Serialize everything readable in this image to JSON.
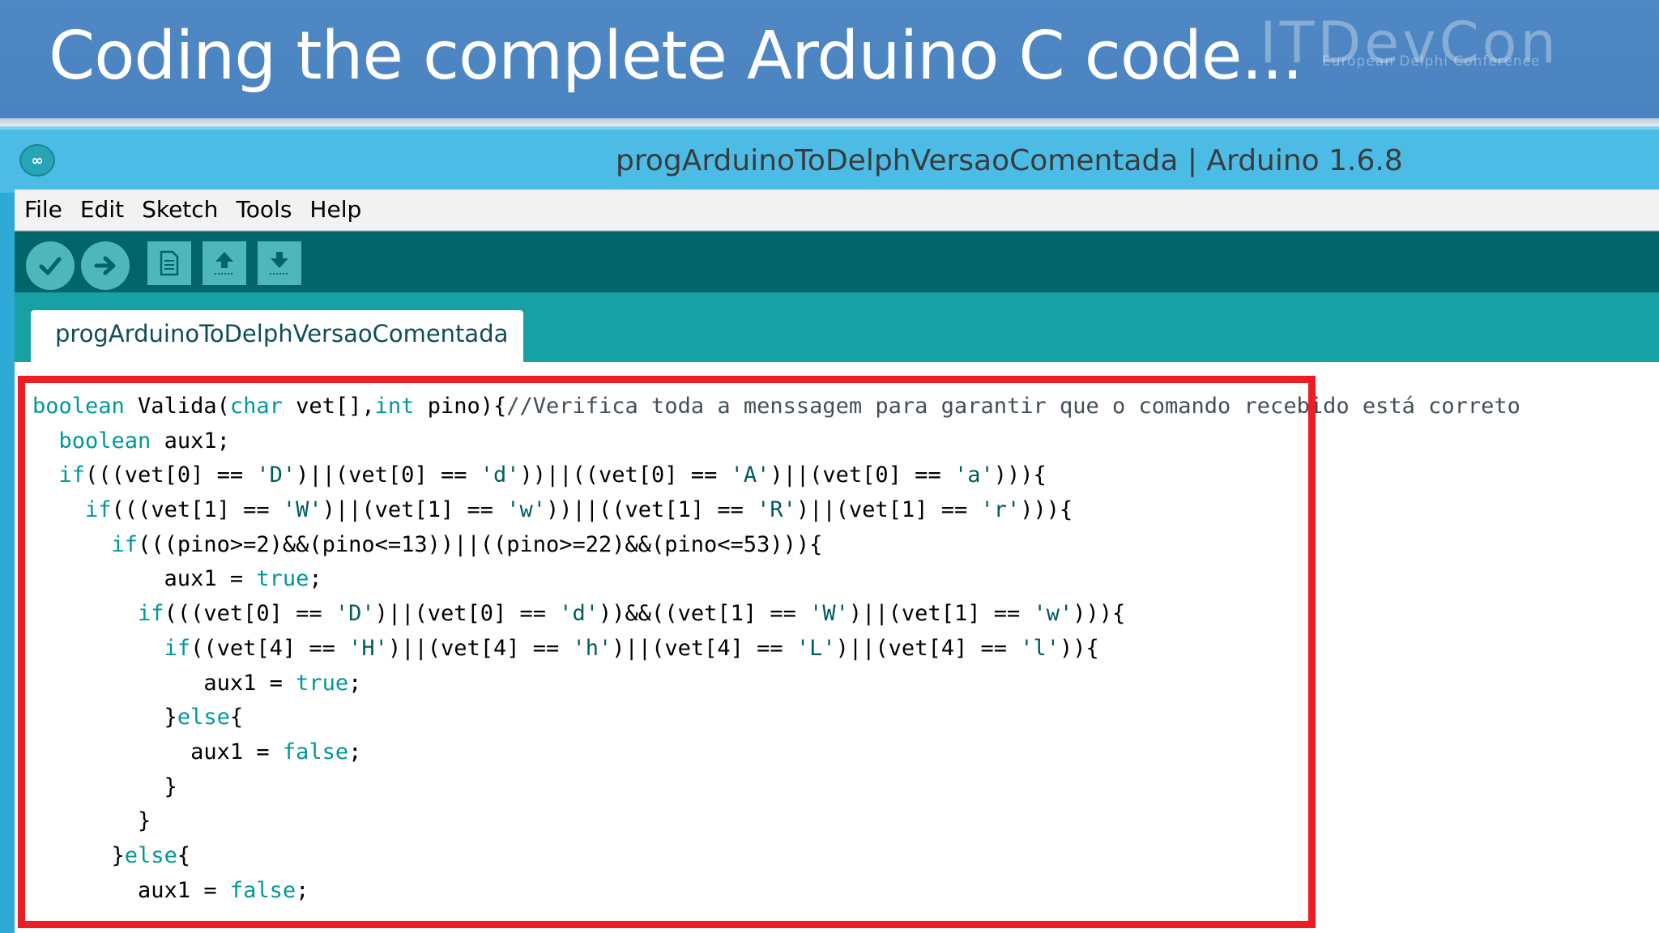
{
  "slide": {
    "title": "Coding the complete Arduino C code...",
    "logo": {
      "name": "ITDevCon",
      "subtitle": "European Delphi Conference"
    }
  },
  "window": {
    "icon": "arduino-infinity-icon",
    "title": "progArduinoToDelphVersaoComentada | Arduino 1.6.8"
  },
  "menu": [
    "File",
    "Edit",
    "Sketch",
    "Tools",
    "Help"
  ],
  "toolbar": [
    {
      "name": "verify",
      "icon": "checkmark-icon"
    },
    {
      "name": "upload",
      "icon": "arrow-right-icon"
    },
    {
      "name": "new",
      "icon": "new-file-icon"
    },
    {
      "name": "open",
      "icon": "open-up-arrow-icon"
    },
    {
      "name": "save",
      "icon": "save-down-arrow-icon"
    }
  ],
  "tab": {
    "label": "progArduinoToDelphVersaoComentada"
  },
  "colors": {
    "keyword": "#00979c",
    "string": "#005c5f",
    "highlight_border": "#ee1c24",
    "toolbar_bg": "#006468",
    "tabbar_bg": "#17a1a5"
  },
  "code": [
    [
      [
        "kw",
        "boolean"
      ],
      [
        "t",
        " Valida("
      ],
      [
        "kw",
        "char"
      ],
      [
        "t",
        " vet[],"
      ],
      [
        "kw",
        "int"
      ],
      [
        "t",
        " pino){"
      ],
      [
        "cm",
        "//Verifica toda a menssagem para garantir que o comando recebido está correto"
      ]
    ],
    [
      [
        "t",
        "  "
      ],
      [
        "kw",
        "boolean"
      ],
      [
        "t",
        " aux1;"
      ]
    ],
    [
      [
        "t",
        "  "
      ],
      [
        "kw",
        "if"
      ],
      [
        "t",
        "(((vet[0] == "
      ],
      [
        "str",
        "'D'"
      ],
      [
        "t",
        ")||(vet[0] == "
      ],
      [
        "str",
        "'d'"
      ],
      [
        "t",
        "))||((vet[0] == "
      ],
      [
        "str",
        "'A'"
      ],
      [
        "t",
        ")||(vet[0] == "
      ],
      [
        "str",
        "'a'"
      ],
      [
        "t",
        ")))"
      ],
      [
        "t",
        "{"
      ]
    ],
    [
      [
        "t",
        "    "
      ],
      [
        "kw",
        "if"
      ],
      [
        "t",
        "(((vet[1] == "
      ],
      [
        "str",
        "'W'"
      ],
      [
        "t",
        ")||(vet[1] == "
      ],
      [
        "str",
        "'w'"
      ],
      [
        "t",
        "))||((vet[1] == "
      ],
      [
        "str",
        "'R'"
      ],
      [
        "t",
        ")||(vet[1] == "
      ],
      [
        "str",
        "'r'"
      ],
      [
        "t",
        ")))"
      ],
      [
        "t",
        "{"
      ]
    ],
    [
      [
        "t",
        "      "
      ],
      [
        "kw",
        "if"
      ],
      [
        "t",
        "(((pino>=2)&&(pino<=13))||((pino>=22)&&(pino<=53))){"
      ]
    ],
    [
      [
        "t",
        "          aux1 = "
      ],
      [
        "kw",
        "true"
      ],
      [
        "t",
        ";"
      ]
    ],
    [
      [
        "t",
        "        "
      ],
      [
        "kw",
        "if"
      ],
      [
        "t",
        "(((vet[0] == "
      ],
      [
        "str",
        "'D'"
      ],
      [
        "t",
        ")||(vet[0] == "
      ],
      [
        "str",
        "'d'"
      ],
      [
        "t",
        "))&&((vet[1] == "
      ],
      [
        "str",
        "'W'"
      ],
      [
        "t",
        ")||(vet[1] == "
      ],
      [
        "str",
        "'w'"
      ],
      [
        "t",
        ")))"
      ],
      [
        "t",
        "{"
      ]
    ],
    [
      [
        "t",
        "          "
      ],
      [
        "kw",
        "if"
      ],
      [
        "t",
        "((vet[4] == "
      ],
      [
        "str",
        "'H'"
      ],
      [
        "t",
        ")||(vet[4] == "
      ],
      [
        "str",
        "'h'"
      ],
      [
        "t",
        ")||(vet[4] == "
      ],
      [
        "str",
        "'L'"
      ],
      [
        "t",
        ")||(vet[4] == "
      ],
      [
        "str",
        "'l'"
      ],
      [
        "t",
        "))"
      ],
      [
        "t",
        "{"
      ]
    ],
    [
      [
        "t",
        "             aux1 = "
      ],
      [
        "kw",
        "true"
      ],
      [
        "t",
        ";"
      ]
    ],
    [
      [
        "t",
        "          }"
      ],
      [
        "kw",
        "else"
      ],
      [
        "t",
        "{"
      ]
    ],
    [
      [
        "t",
        "            aux1 = "
      ],
      [
        "kw",
        "false"
      ],
      [
        "t",
        ";"
      ]
    ],
    [
      [
        "t",
        "          }"
      ]
    ],
    [
      [
        "t",
        "        }"
      ]
    ],
    [
      [
        "t",
        "      }"
      ],
      [
        "kw",
        "else"
      ],
      [
        "t",
        "{"
      ]
    ],
    [
      [
        "t",
        "        aux1 = "
      ],
      [
        "kw",
        "false"
      ],
      [
        "t",
        ";"
      ]
    ]
  ]
}
